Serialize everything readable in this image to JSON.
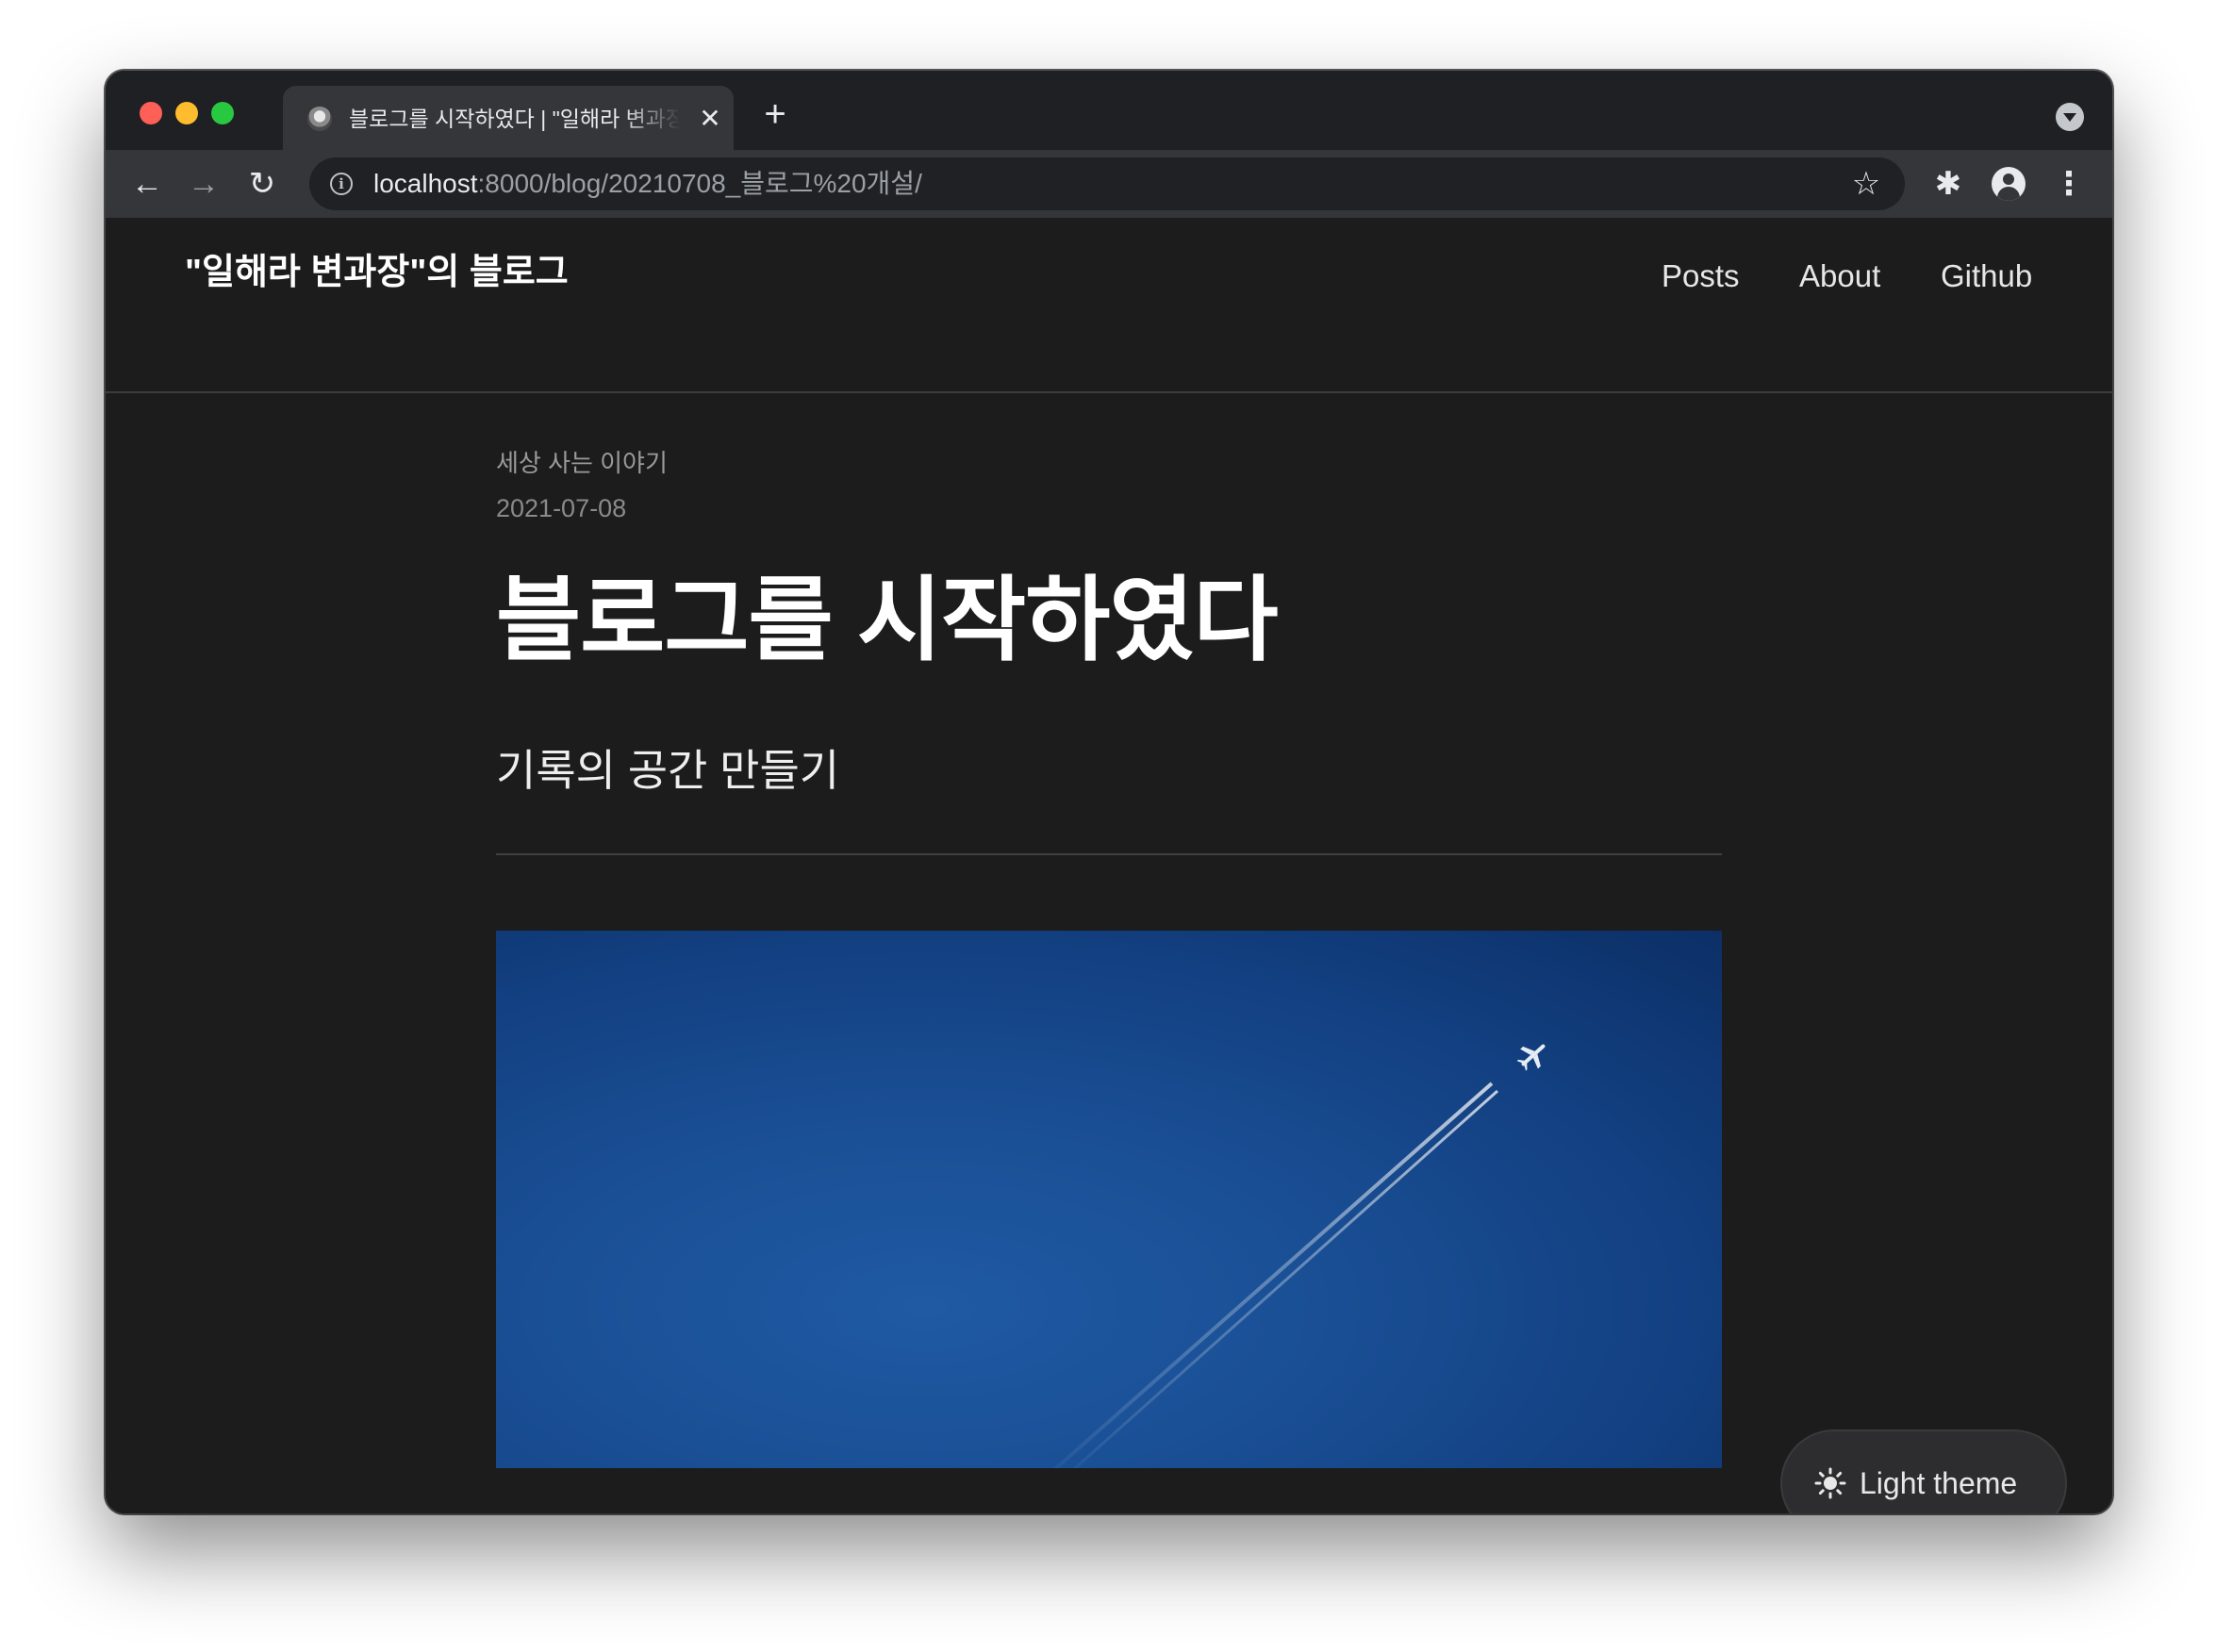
{
  "browser": {
    "tab": {
      "title": "블로그를 시작하였다 | \"일해라 변과장\"의 블로그",
      "close_glyph": "✕"
    },
    "new_tab_glyph": "+",
    "nav": {
      "back": "←",
      "forward": "→",
      "reload": "↻"
    },
    "url": {
      "host": "localhost",
      "path": ":8000/blog/20210708_블로그%20개설/"
    },
    "icons": {
      "info": "i",
      "star": "☆",
      "extensions": "✱",
      "menu": "⋮"
    },
    "traffic_lights": {
      "close": "#fe5f57",
      "minimize": "#febc2e",
      "maximize": "#28c840"
    }
  },
  "site": {
    "title": "\"일해라 변과장\"의 블로그",
    "nav": [
      {
        "label": "Posts"
      },
      {
        "label": "About"
      },
      {
        "label": "Github"
      }
    ]
  },
  "post": {
    "category": "세상 사는 이야기",
    "date": "2021-07-08",
    "title": "블로그를 시작하였다",
    "subtitle": "기록의 공간 만들기",
    "hero_image": "blue sky with airplane contrail"
  },
  "theme_toggle": {
    "label": "Light theme",
    "icon": "sun-icon"
  },
  "colors": {
    "page_bg": "#1c1c1d",
    "accent_sky": "#1a4f95"
  }
}
